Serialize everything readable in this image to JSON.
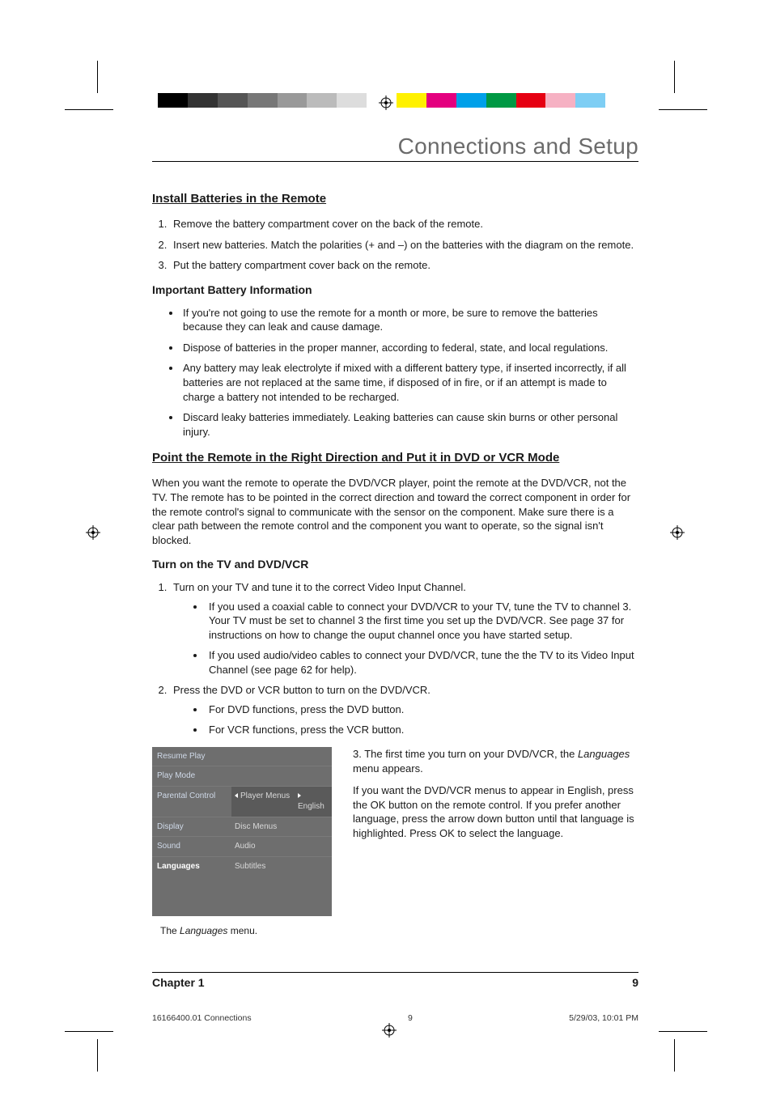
{
  "header": {
    "title": "Connections and Setup"
  },
  "s1": {
    "title": "Install Batteries in the Remote",
    "steps": [
      "Remove the battery compartment cover on the back of the remote.",
      "Insert new batteries. Match the polarities (+ and –) on the batteries with the diagram on the remote.",
      "Put the battery compartment cover back on the remote."
    ],
    "sub": "Important Battery Information",
    "bullets": [
      "If you're not going to use the remote for a month or more, be sure to remove the batteries because they can leak and cause damage.",
      "Dispose of batteries in the proper manner, according to federal, state, and local regulations.",
      "Any battery may leak electrolyte if mixed with a different battery type, if inserted incorrectly, if all batteries are not replaced at the same time, if disposed of in fire, or if an attempt is made to charge a battery not intended to be recharged.",
      "Discard leaky batteries immediately. Leaking batteries can cause skin burns or other personal injury."
    ]
  },
  "s2": {
    "title": "Point the Remote in the Right Direction and Put it in DVD or VCR Mode",
    "para": "When you want the remote to operate the DVD/VCR player, point the remote at the DVD/VCR, not the TV. The remote has to be pointed in the correct direction and toward the correct component in order for the remote control's signal to communicate with the sensor on the component. Make sure there is a clear path between the remote control and the component you want to operate, so the signal isn't blocked.",
    "sub": "Turn on the TV and DVD/VCR",
    "step1": "Turn on your TV and tune it to the correct Video Input Channel.",
    "step1sub": [
      "If you used a coaxial cable to connect your DVD/VCR to your TV, tune the TV to channel 3. Your TV must be set to channel 3 the first time you set up the DVD/VCR. See page 37 for instructions on how to change the ouput channel once you have started setup.",
      "If you used audio/video cables to connect your DVD/VCR, tune the the TV to its Video Input Channel (see page 62 for help)."
    ],
    "step2": "Press the DVD or VCR button to turn on the DVD/VCR.",
    "step2sub": [
      "For DVD functions, press the DVD button.",
      "For VCR functions, press the VCR button."
    ],
    "step3_prefix": "3.  ",
    "step3_a": "The first time you turn on your DVD/VCR, the ",
    "step3_i": "Languages",
    "step3_b": " menu appears.",
    "step3_para": "If you want the DVD/VCR menus to appear in English, press the OK button on the remote control. If you prefer another language, press the arrow down button until that language is highlighted. Press OK to select the language."
  },
  "menu": {
    "left": [
      "Resume Play",
      "Play Mode",
      "Parental Control",
      "Display",
      "Sound",
      "Languages"
    ],
    "mid_player": "Player Menus",
    "mid_disc": "Disc Menus",
    "mid_audio": "Audio",
    "mid_sub": "Subtitles",
    "right_en": "English",
    "caption_a": "The ",
    "caption_i": "Languages",
    "caption_b": " menu."
  },
  "footer": {
    "chapter": "Chapter 1",
    "page": "9"
  },
  "imprint": {
    "file": "16166400.01 Connections",
    "pnum": "9",
    "date": "5/29/03, 10:01 PM"
  },
  "colors": {
    "bar": [
      "#000",
      "#333",
      "#555",
      "#777",
      "#999",
      "#bbb",
      "#ddd",
      "#fff",
      "#fff100",
      "#e4007f",
      "#00a0e9",
      "#009944",
      "#e60012",
      "#f6b1c3",
      "#7ecef4",
      "#fff"
    ]
  }
}
